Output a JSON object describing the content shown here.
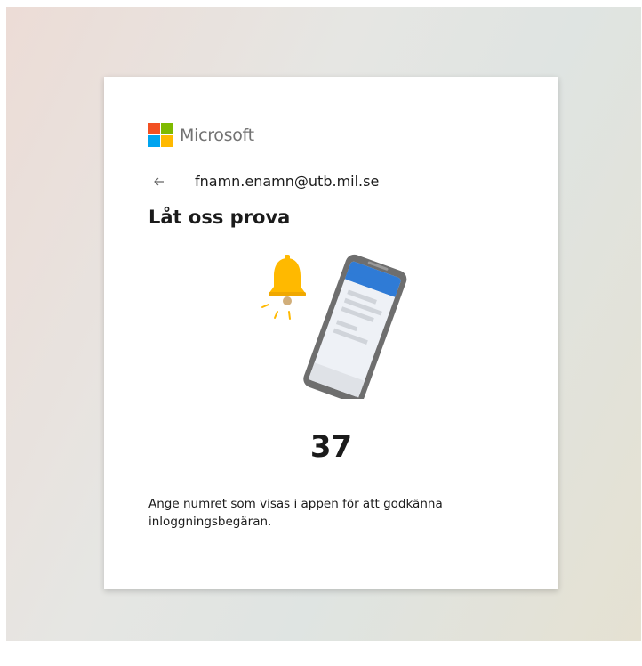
{
  "brand": {
    "name": "Microsoft",
    "colors": [
      "#f25022",
      "#7fba00",
      "#00a4ef",
      "#ffb900"
    ]
  },
  "identity": {
    "back_icon": "back-arrow-icon",
    "email": "fnamn.enamn@utb.mil.se"
  },
  "title": "Låt oss prova",
  "illustration": {
    "icons": [
      "bell-icon",
      "phone-icon"
    ],
    "bell_color": "#ffb900",
    "phone_header_color": "#2f7bd6"
  },
  "code": "37",
  "description": "Ange numret som visas i appen för att godkänna inloggningsbegäran."
}
